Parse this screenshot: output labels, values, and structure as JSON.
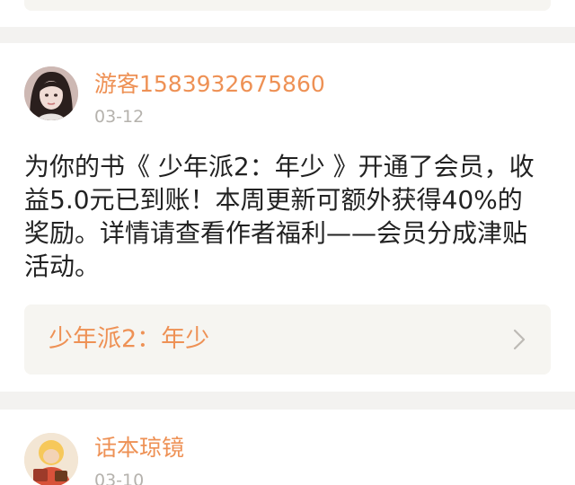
{
  "notifications": [
    {
      "username": "游客1583932675860",
      "date": "03-12",
      "avatar_icon": "female-user-avatar",
      "message": "为你的书《 少年派2：年少 》开通了会员，收益5.0元已到账！本周更新可额外获得40%的奖励。详情请查看作者福利——会员分成津贴活动。",
      "book_title": "少年派2：年少",
      "link_icon": "chevron-right-icon"
    },
    {
      "username": "话本琼镜",
      "date": "03-10",
      "avatar_icon": "cartoon-user-avatar"
    }
  ],
  "colors": {
    "accent": "#ee9155",
    "background": "#f3f2f0",
    "card": "#ffffff",
    "link_box": "#f6f5f1",
    "text": "#222222",
    "muted": "#b5b2ad"
  }
}
